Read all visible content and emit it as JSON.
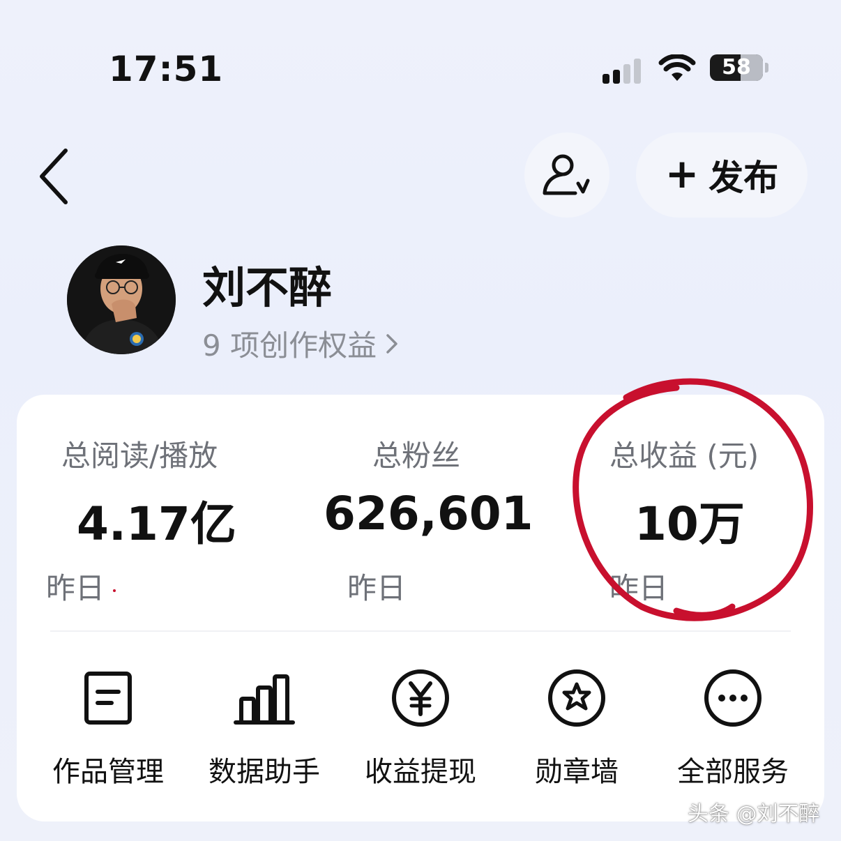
{
  "status_bar": {
    "time": "17:51",
    "battery_level": "58",
    "battery_percent": 58
  },
  "nav": {
    "back_icon": "chevron-left-icon",
    "follow_icon": "user-check-icon",
    "publish_plus": "+",
    "publish_label": "发布"
  },
  "profile": {
    "name": "刘不醉",
    "rights_link": "9 项创作权益",
    "rights_chevron": "›"
  },
  "stats": [
    {
      "label": "总阅读/播放",
      "value": "4.17亿",
      "sub": "昨日"
    },
    {
      "label": "总粉丝",
      "value": "626,601",
      "sub": "昨日"
    },
    {
      "label": "总收益 (元)",
      "value": "10万",
      "sub": "昨日"
    }
  ],
  "services": [
    {
      "label": "作品管理",
      "icon": "document-icon"
    },
    {
      "label": "数据助手",
      "icon": "bar-chart-icon"
    },
    {
      "label": "收益提现",
      "icon": "yen-circle-icon"
    },
    {
      "label": "勋章墙",
      "icon": "medal-star-icon"
    },
    {
      "label": "全部服务",
      "icon": "more-circle-icon"
    }
  ],
  "watermark": "头条 @刘不醉",
  "colors": {
    "background": "#eef1fb",
    "card": "#ffffff",
    "annotation_red": "#c8102e",
    "secondary_text": "#6e7178"
  }
}
